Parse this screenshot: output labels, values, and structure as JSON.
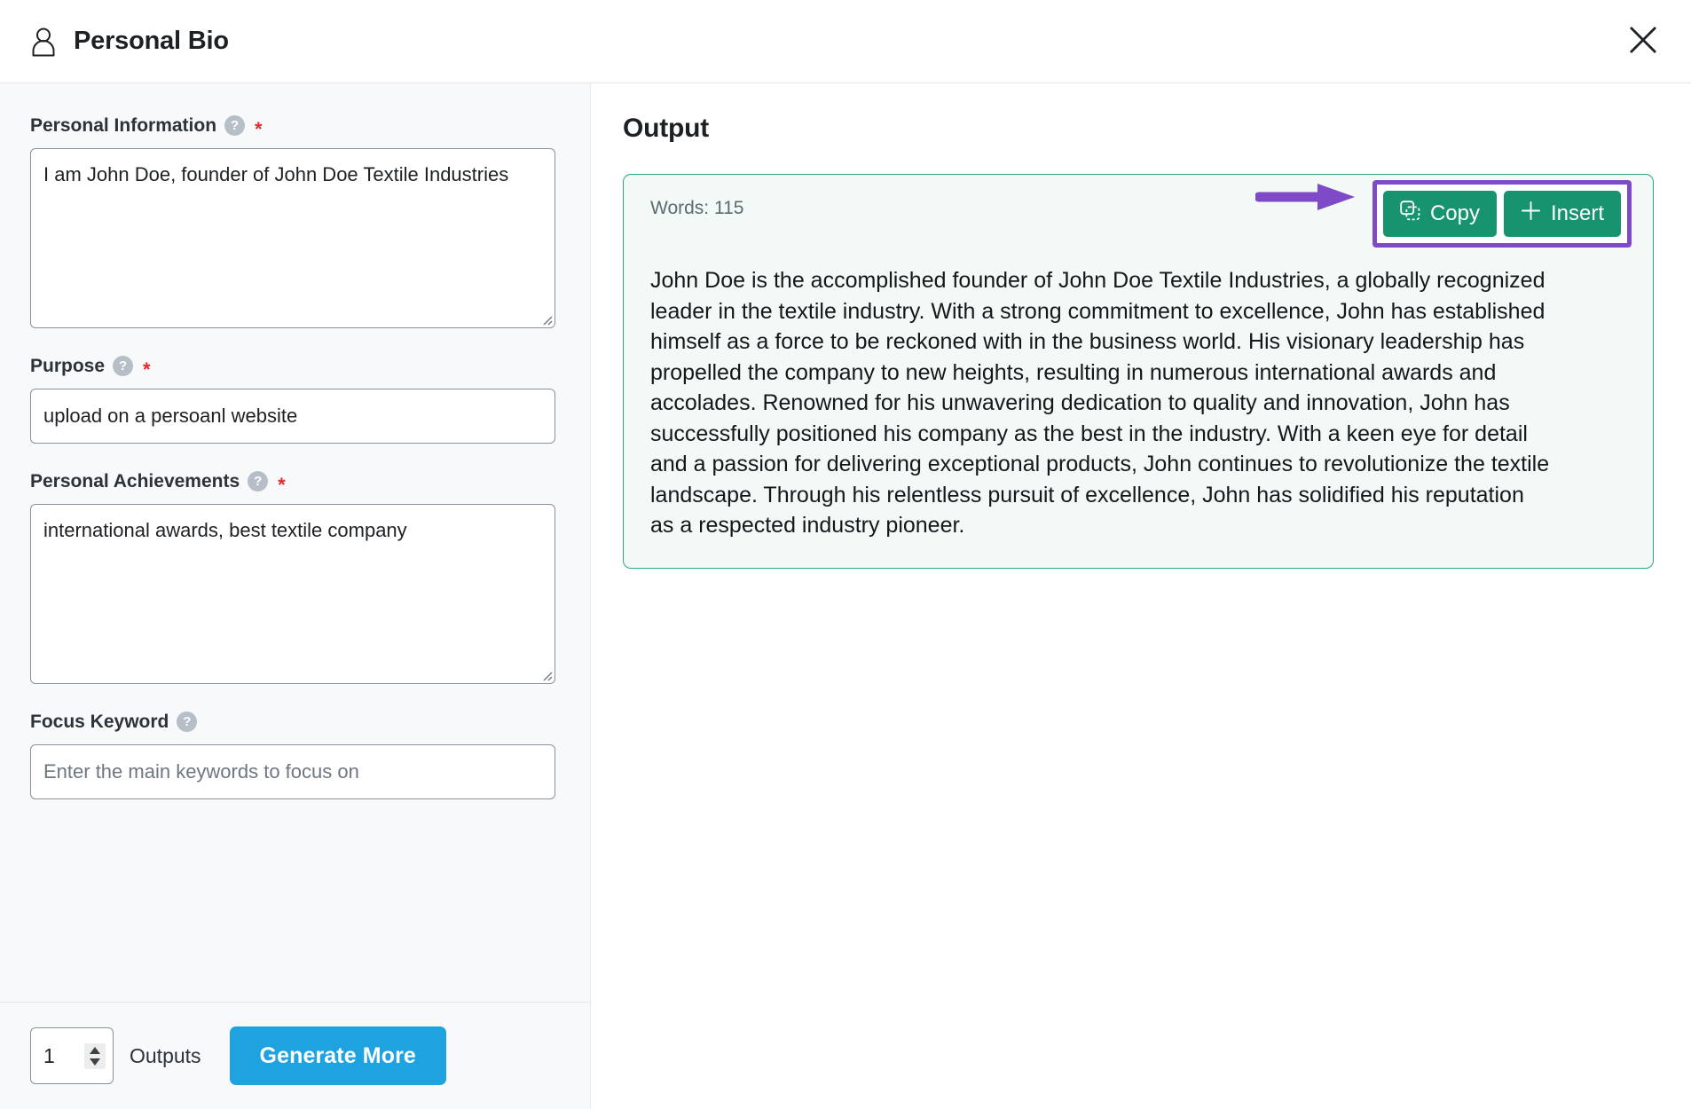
{
  "header": {
    "title": "Personal Bio",
    "person_icon": "person-icon",
    "close_icon": "close-icon"
  },
  "form": {
    "fields": [
      {
        "label": "Personal Information",
        "required": true,
        "help_icon": "help-icon",
        "type": "textarea",
        "value": "I am John Doe, founder of John Doe Textile Industries",
        "placeholder": ""
      },
      {
        "label": "Purpose",
        "required": true,
        "help_icon": "help-icon",
        "type": "text",
        "value": "upload on a persoanl website",
        "placeholder": ""
      },
      {
        "label": "Personal Achievements",
        "required": true,
        "help_icon": "help-icon",
        "type": "textarea",
        "value": "international awards, best textile company",
        "placeholder": ""
      },
      {
        "label": "Focus Keyword",
        "required": false,
        "help_icon": "help-icon",
        "type": "text",
        "value": "",
        "placeholder": "Enter the main keywords to focus on"
      }
    ],
    "help_glyph": "?",
    "required_glyph": "*",
    "footer": {
      "outputs_value": "1",
      "outputs_label": "Outputs",
      "generate_label": "Generate More"
    }
  },
  "output": {
    "title": "Output",
    "words_label": "Words: 115",
    "copy_label": "Copy",
    "insert_label": "Insert",
    "copy_icon": "copy-icon",
    "insert_icon": "plus-icon",
    "body": "John Doe is the accomplished founder of John Doe Textile Industries, a globally recognized leader in the textile industry. With a strong commitment to excellence, John has established himself as a force to be reckoned with in the business world. His visionary leadership has propelled the company to new heights, resulting in numerous international awards and accolades. Renowned for his unwavering dedication to quality and innovation, John has successfully positioned his company as the best in the industry. With a keen eye for detail and a passion for delivering exceptional products, John continues to revolutionize the textile landscape. Through his relentless pursuit of excellence, John has solidified his reputation as a respected industry pioneer."
  },
  "colors": {
    "accent_blue": "#1ea2e0",
    "accent_teal": "#17946f",
    "card_border_teal": "#2ba884",
    "card_bg_mint": "#f2f9f6",
    "annotation_purple": "#7f4ac7",
    "required_red": "#e02b2b",
    "panel_bg": "#f7f9fa"
  }
}
